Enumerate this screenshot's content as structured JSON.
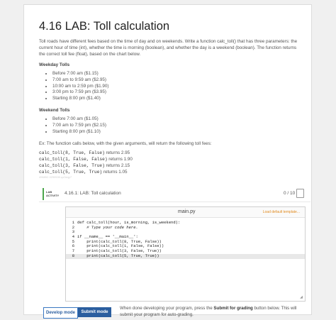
{
  "title": "4.16 LAB: Toll calculation",
  "intro": "Toll roads have different fees based on the time of day and on weekends. Write a function calc_toll() that has three parameters: the current hour of time (int), whether the time is morning (boolean), and whether the day is a weekend (boolean). The function returns the correct toll fee (float), based on the chart below.",
  "weekday": {
    "heading": "Weekday Tolls",
    "items": [
      "Before 7:00 am ($1.15)",
      "7:00 am to 9:59 am ($2.95)",
      "10:00 am to 2:59 pm ($1.90)",
      "3:00 pm to 7:59 pm ($3.95)",
      "Starting 8:00 pm ($1.40)"
    ]
  },
  "weekend": {
    "heading": "Weekend Tolls",
    "items": [
      "Before 7:00 am ($1.05)",
      "7:00 am to 7:59 pm ($2.15)",
      "Starting 8:00 pm ($1.10)"
    ]
  },
  "example": {
    "intro": "Ex: The function calls below, with the given arguments, will return the following toll fees:",
    "calls": [
      {
        "code": "calc_toll(8, True, False)",
        "text": " returns 2.95"
      },
      {
        "code": "calc_toll(1, False, False)",
        "text": " returns 1.90"
      },
      {
        "code": "calc_toll(3, False, True)",
        "text": " returns 2.15"
      },
      {
        "code": "calc_toll(5, True, True)",
        "text": " returns 1.05"
      }
    ]
  },
  "tiny_id": "496852.2290530.qx3zqy7",
  "lab": {
    "tag_line1": "LAB",
    "tag_line2": "ACTIVITY",
    "title": "4.16.1: LAB: Toll calculation",
    "score": "0 / 10",
    "filename": "main.py",
    "load_template": "Load default template...",
    "code_lines": [
      {
        "num": "1",
        "text": "def calc_toll(hour, is_morning, is_weekend):"
      },
      {
        "num": "2",
        "text": "    # Type your code here."
      },
      {
        "num": "3",
        "text": ""
      },
      {
        "num": "4",
        "text": "if __name__ == '__main__':"
      },
      {
        "num": "5",
        "text": "    print(calc_toll(8, True, False))"
      },
      {
        "num": "6",
        "text": "    print(calc_toll(1, False, False))"
      },
      {
        "num": "7",
        "text": "    print(calc_toll(3, False, True))"
      },
      {
        "num": "8",
        "text": "    print(calc_toll(5, True, True))"
      }
    ],
    "develop_label": "Develop mode",
    "submit_label": "Submit mode",
    "submit_note_pre": "When done developing your program, press the ",
    "submit_note_bold": "Submit for grading",
    "submit_note_post": " button below. This will submit your program for auto-grading."
  }
}
